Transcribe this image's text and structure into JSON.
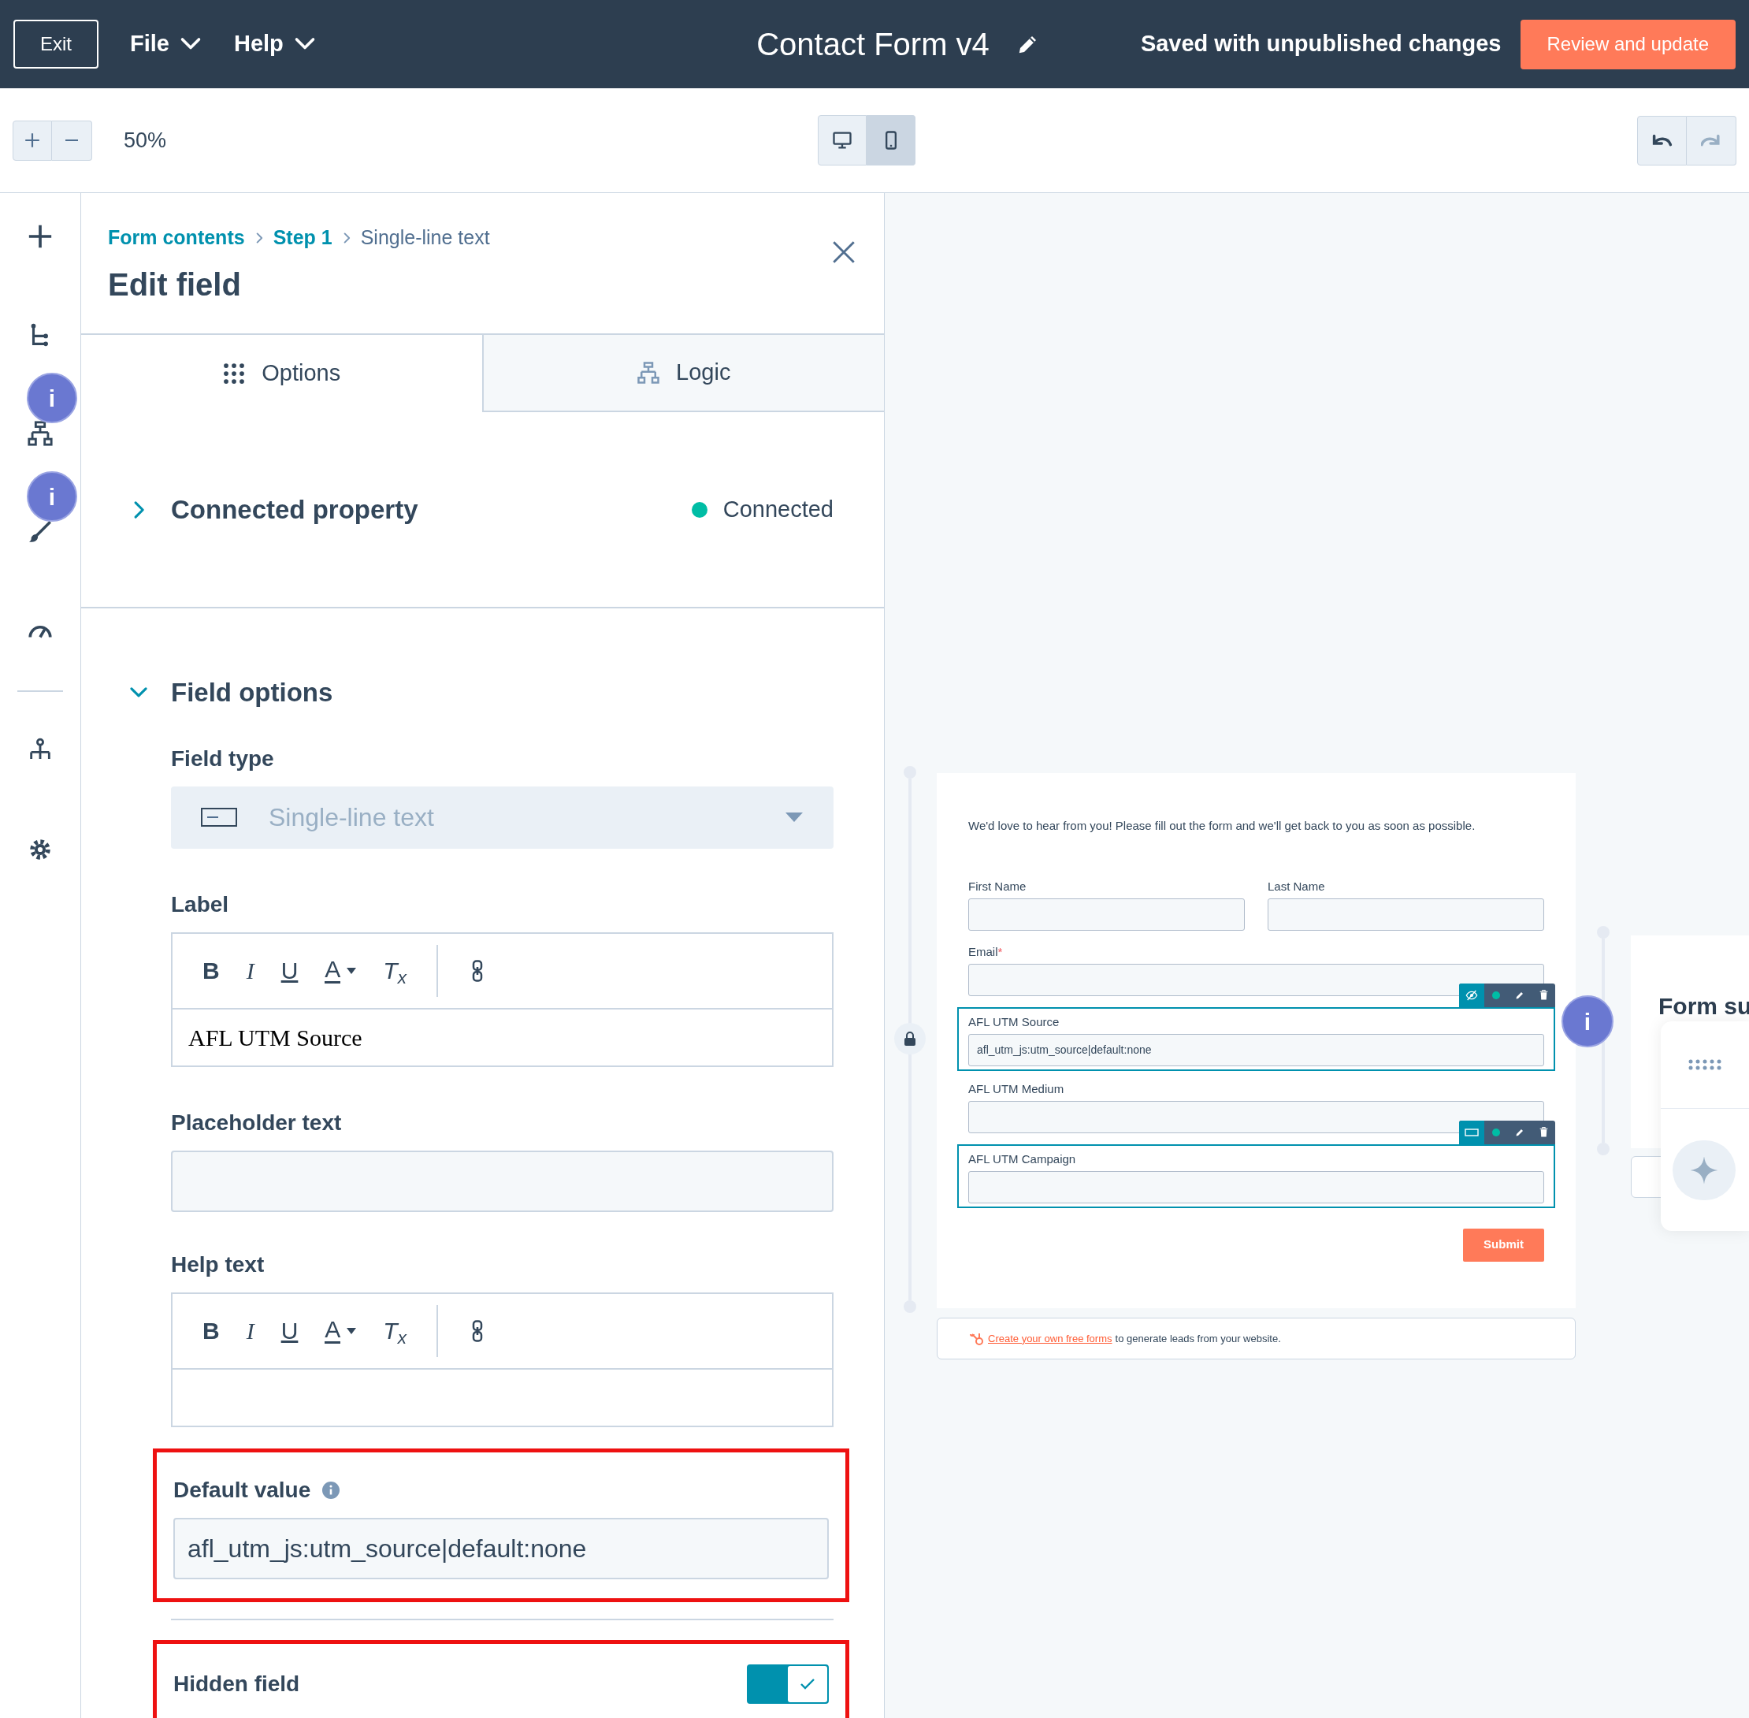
{
  "header": {
    "exit": "Exit",
    "menus": [
      {
        "label": "File"
      },
      {
        "label": "Help"
      }
    ],
    "title": "Contact Form v4",
    "status": "Saved with unpublished changes",
    "primary_button": "Review and update"
  },
  "toolbar": {
    "zoom": "50%",
    "devices": [
      {
        "kind": "desktop",
        "selected": false
      },
      {
        "kind": "mobile",
        "selected": true
      }
    ],
    "history": [
      {
        "kind": "undo",
        "disabled": false
      },
      {
        "kind": "redo",
        "disabled": true
      }
    ]
  },
  "rail": {
    "items": [
      {
        "kind": "add"
      },
      {
        "kind": "tree"
      },
      {
        "kind": "branching",
        "badge": "i"
      },
      {
        "kind": "brush",
        "badge": "i"
      },
      {
        "kind": "gauge"
      },
      {
        "kind": "divider"
      },
      {
        "kind": "hierarchy"
      },
      {
        "kind": "settings"
      }
    ]
  },
  "panel": {
    "breadcrumb": [
      {
        "label": "Form contents",
        "link": true
      },
      {
        "label": "Step 1",
        "link": true
      },
      {
        "label": "Single-line text",
        "link": false
      }
    ],
    "title": "Edit field",
    "tabs": [
      {
        "label": "Options",
        "kind": "grid",
        "selected": true
      },
      {
        "label": "Logic",
        "kind": "branching",
        "selected": false
      }
    ],
    "connected_property": {
      "title": "Connected property",
      "expanded": false,
      "status": "Connected",
      "color": "#00bda5"
    },
    "field_options": {
      "title": "Field options",
      "expanded": true,
      "field_type": {
        "label": "Field type",
        "value": "Single-line text",
        "disabled": true
      },
      "label": {
        "label": "Label",
        "value": "AFL UTM Source",
        "toolbar": [
          {
            "kind": "bold",
            "label": "B"
          },
          {
            "kind": "italic",
            "label": "I"
          },
          {
            "kind": "underline",
            "label": "U"
          },
          {
            "kind": "color",
            "label": "A"
          },
          {
            "kind": "clear",
            "label": "T$_{x}$"
          },
          {
            "kind": "link"
          }
        ]
      },
      "placeholder_text": {
        "label": "Placeholder text"
      },
      "help_text": {
        "label": "Help text",
        "toolbar": [
          {
            "kind": "bold",
            "label": "B"
          },
          {
            "kind": "italic",
            "label": "I"
          },
          {
            "kind": "underline",
            "label": "U"
          },
          {
            "kind": "color",
            "label": "A"
          },
          {
            "kind": "clear",
            "label": "T$_{x}$"
          },
          {
            "kind": "link"
          }
        ]
      },
      "default_value": {
        "label": "Default value",
        "value": "afl_utm_js:utm_source|default:none",
        "highlighted": true
      },
      "hidden_field": {
        "label": "Hidden field",
        "on": true,
        "highlighted": true
      }
    }
  },
  "preview": {
    "intro": "We'd love to hear from you! Please fill out the form and we'll get back to you as soon as possible.",
    "fields": [
      {
        "label": "First Name",
        "kind": "half",
        "required": false,
        "selected": false
      },
      {
        "label": "Last Name",
        "kind": "half",
        "required": false,
        "selected": false
      },
      {
        "label": "Email",
        "kind": "full",
        "required": true,
        "selected": false
      },
      {
        "label": "AFL UTM Source",
        "kind": "full",
        "required": false,
        "selected": true,
        "hidden": true,
        "value": "afl_utm_js:utm_source|default:none"
      },
      {
        "label": "AFL UTM Medium",
        "kind": "full",
        "required": false,
        "selected": false
      },
      {
        "label": "AFL UTM Campaign",
        "kind": "full",
        "required": false,
        "selected": true,
        "hidden": false
      }
    ],
    "required_mark": "*",
    "submit": "Submit",
    "footer_link": "Create your own free forms",
    "footer_text": "to generate leads from your website.",
    "badge": "i"
  },
  "side_card": {
    "title": "Form su"
  }
}
